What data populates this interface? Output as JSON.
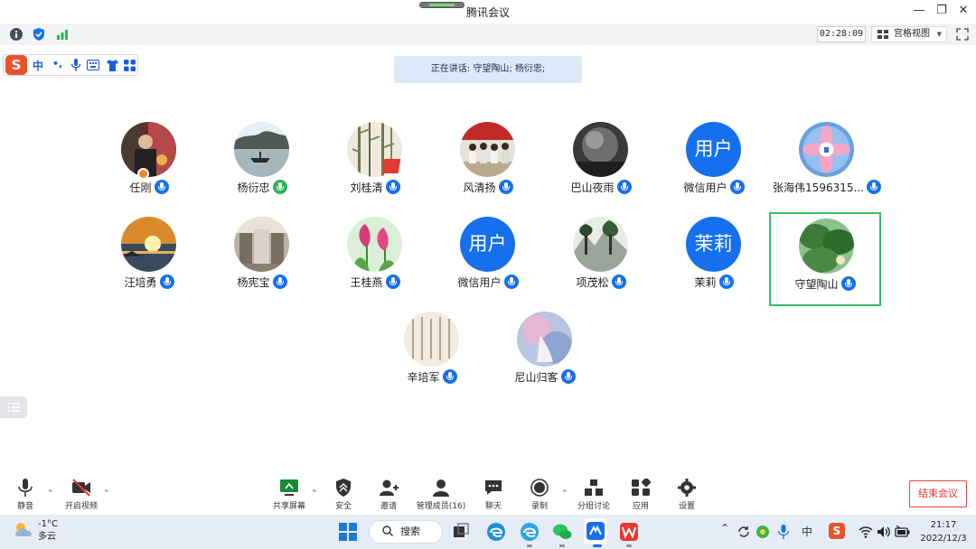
{
  "window": {
    "title": "腾讯会议"
  },
  "infobar": {
    "timer": "02:28:09",
    "view_label": "宫格视图"
  },
  "ime": {
    "mode_label": "中",
    "punct_label": "•,"
  },
  "banner": {
    "text": "正在讲话: 守望陶山; 杨衍忠;"
  },
  "participants": [
    {
      "name": "任刚",
      "avatar": "photo"
    },
    {
      "name": "杨衍忠",
      "avatar": "photo"
    },
    {
      "name": "刘桂清",
      "avatar": "photo"
    },
    {
      "name": "风清扬",
      "avatar": "photo"
    },
    {
      "name": "巴山夜雨",
      "avatar": "photo"
    },
    {
      "name": "微信用户",
      "avatar_text": "用户"
    },
    {
      "name": "张海伟1596315...",
      "avatar": "photo"
    },
    {
      "name": "汪培勇",
      "avatar": "photo"
    },
    {
      "name": "杨宪宝",
      "avatar": "photo"
    },
    {
      "name": "王桂燕",
      "avatar": "photo"
    },
    {
      "name": "微信用户",
      "avatar_text": "用户"
    },
    {
      "name": "项茂松",
      "avatar": "photo"
    },
    {
      "name": "茉莉",
      "avatar_text": "茉莉"
    },
    {
      "name": "守望陶山",
      "avatar": "photo"
    },
    {
      "name": "辛培军",
      "avatar": "photo"
    },
    {
      "name": "尼山归客",
      "avatar": "photo"
    }
  ],
  "toolbar": {
    "mute": "静音",
    "video": "开启视频",
    "share": "共享屏幕",
    "security": "安全",
    "invite": "邀请",
    "members": "管理成员(16)",
    "chat": "聊天",
    "record": "录制",
    "breakout": "分组讨论",
    "apps": "应用",
    "settings": "设置",
    "end": "结束会议"
  },
  "taskbar": {
    "temp": "-1°C",
    "weather": "多云",
    "search": "搜索",
    "time": "21:17",
    "date": "2022/12/3",
    "tray_ime": "中"
  },
  "colors": {
    "accent": "#1670ee",
    "active_border": "#37c16a",
    "end_red": "#e33333",
    "banner_bg": "#dce8f8"
  }
}
